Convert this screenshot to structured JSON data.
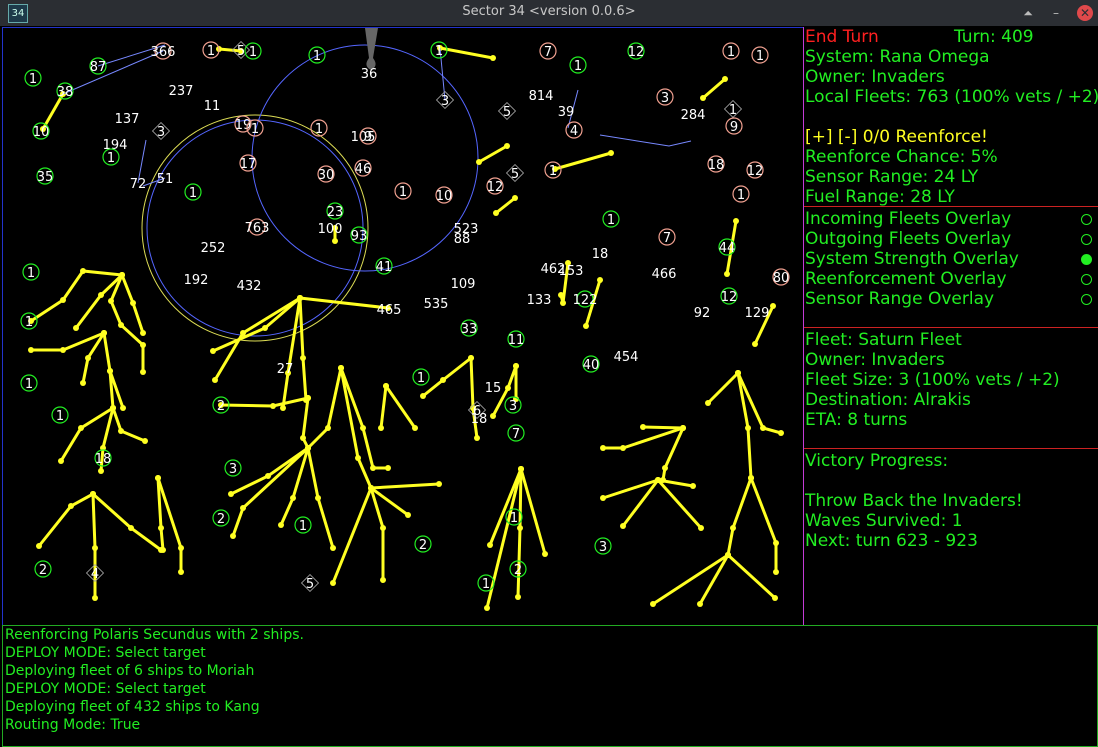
{
  "window": {
    "icon_label": "34",
    "title": "Sector 34   <version 0.0.6>",
    "buttons": [
      "minimize-up",
      "minimize",
      "close"
    ]
  },
  "side": {
    "end_turn": "End Turn",
    "turn": "Turn: 409",
    "system": "System: Rana Omega",
    "owner": "Owner: Invaders",
    "local_fleets": "Local Fleets: 763 (100% vets / +2)",
    "reenforce_plus": "[+]",
    "reenforce_minus": "[-]",
    "reenforce_status": "0/0 Reenforce!",
    "reenforce_chance": "Reenforce Chance: 5%",
    "sensor_range": "Sensor Range: 24 LY",
    "fuel_range": "Fuel Range: 28 LY",
    "overlays": [
      {
        "label": "Incoming Fleets Overlay",
        "on": false
      },
      {
        "label": "Outgoing Fleets Overlay",
        "on": false
      },
      {
        "label": "System Strength Overlay",
        "on": true
      },
      {
        "label": "Reenforcement Overlay",
        "on": false
      },
      {
        "label": "Sensor Range Overlay",
        "on": false
      }
    ],
    "fleet_name": "Fleet: Saturn Fleet",
    "fleet_owner": "Owner: Invaders",
    "fleet_size": "Fleet Size: 3 (100% vets / +2)",
    "fleet_dest": "Destination: Alrakis",
    "fleet_eta": "ETA: 8 turns",
    "victory_title": "Victory Progress:",
    "victory_goal": "Throw Back the Invaders!",
    "waves": "Waves Survived: 1",
    "next_turn": "Next: turn 623 - 923"
  },
  "log": [
    "Reenforcing Polaris Secundus with 2 ships.",
    "DEPLOY MODE: Select target",
    "Deploying fleet of 6 ships to Moriah",
    "DEPLOY MODE: Select target",
    "Deploying fleet of 432 ships to Kang",
    "Routing Mode: True"
  ],
  "colors": {
    "player": "#22ee22",
    "enemy": "#f0a090",
    "neutral": "#ffffff",
    "fleet_route": "#ffff22",
    "sensor_ring": "#5566ff",
    "fuel_ring": "#dddd55"
  },
  "map": {
    "stars": [
      {
        "label": "1",
        "kind": "p"
      },
      {
        "label": "87",
        "kind": "p"
      },
      {
        "label": "38",
        "kind": "p"
      },
      {
        "label": "10",
        "kind": "p"
      },
      {
        "label": "366",
        "kind": "e"
      },
      {
        "label": "1",
        "kind": "e"
      },
      {
        "label": "5",
        "kind": "n"
      },
      {
        "label": "1",
        "kind": "p"
      },
      {
        "label": "36",
        "kind": "n"
      },
      {
        "label": "1",
        "kind": "p"
      },
      {
        "label": "1",
        "kind": "p"
      },
      {
        "label": "7",
        "kind": "e"
      },
      {
        "label": "12",
        "kind": "p"
      },
      {
        "label": "1",
        "kind": "e"
      },
      {
        "label": "1",
        "kind": "e"
      },
      {
        "label": "237",
        "kind": "n"
      },
      {
        "label": "11",
        "kind": "n"
      },
      {
        "label": "3",
        "kind": "n"
      },
      {
        "label": "137",
        "kind": "n"
      },
      {
        "label": "194",
        "kind": "n"
      },
      {
        "label": "1",
        "kind": "p"
      },
      {
        "label": "3",
        "kind": "n"
      },
      {
        "label": "19",
        "kind": "e"
      },
      {
        "label": "1",
        "kind": "e"
      },
      {
        "label": "105",
        "kind": "n"
      },
      {
        "label": "9",
        "kind": "e"
      },
      {
        "label": "1",
        "kind": "e"
      },
      {
        "label": "5",
        "kind": "n"
      },
      {
        "label": "814",
        "kind": "n"
      },
      {
        "label": "39",
        "kind": "n"
      },
      {
        "label": "1",
        "kind": "p"
      },
      {
        "label": "4",
        "kind": "e"
      },
      {
        "label": "3",
        "kind": "e"
      },
      {
        "label": "284",
        "kind": "n"
      },
      {
        "label": "1",
        "kind": "n"
      },
      {
        "label": "9",
        "kind": "e"
      },
      {
        "label": "35",
        "kind": "p"
      },
      {
        "label": "72",
        "kind": "n"
      },
      {
        "label": "51",
        "kind": "n"
      },
      {
        "label": "17",
        "kind": "e"
      },
      {
        "label": "30",
        "kind": "e"
      },
      {
        "label": "46",
        "kind": "e"
      },
      {
        "label": "1",
        "kind": "e"
      },
      {
        "label": "10",
        "kind": "e"
      },
      {
        "label": "12",
        "kind": "e"
      },
      {
        "label": "5",
        "kind": "n"
      },
      {
        "label": "1",
        "kind": "e"
      },
      {
        "label": "18",
        "kind": "e"
      },
      {
        "label": "12",
        "kind": "e"
      },
      {
        "label": "1",
        "kind": "p"
      },
      {
        "label": "23",
        "kind": "p"
      },
      {
        "label": "100",
        "kind": "n"
      },
      {
        "label": "93",
        "kind": "p"
      },
      {
        "label": "763",
        "kind": "e"
      },
      {
        "label": "252",
        "kind": "n"
      },
      {
        "label": "523",
        "kind": "n"
      },
      {
        "label": "88",
        "kind": "n"
      },
      {
        "label": "1",
        "kind": "p"
      },
      {
        "label": "462",
        "kind": "n"
      },
      {
        "label": "153",
        "kind": "n"
      },
      {
        "label": "18",
        "kind": "n"
      },
      {
        "label": "7",
        "kind": "e"
      },
      {
        "label": "466",
        "kind": "n"
      },
      {
        "label": "44",
        "kind": "p"
      },
      {
        "label": "1",
        "kind": "e"
      },
      {
        "label": "192",
        "kind": "n"
      },
      {
        "label": "41",
        "kind": "p"
      },
      {
        "label": "432",
        "kind": "n"
      },
      {
        "label": "109",
        "kind": "n"
      },
      {
        "label": "535",
        "kind": "n"
      },
      {
        "label": "465",
        "kind": "n"
      },
      {
        "label": "133",
        "kind": "n"
      },
      {
        "label": "122",
        "kind": "p"
      },
      {
        "label": "92",
        "kind": "n"
      },
      {
        "label": "12",
        "kind": "p"
      },
      {
        "label": "129",
        "kind": "n"
      },
      {
        "label": "80",
        "kind": "e"
      },
      {
        "label": "33",
        "kind": "p"
      },
      {
        "label": "11",
        "kind": "p"
      },
      {
        "label": "454",
        "kind": "n"
      },
      {
        "label": "40",
        "kind": "p"
      },
      {
        "label": "27",
        "kind": "n"
      },
      {
        "label": "15",
        "kind": "n"
      },
      {
        "label": "18",
        "kind": "p"
      },
      {
        "label": "6",
        "kind": "n"
      },
      {
        "label": "3",
        "kind": "p"
      },
      {
        "label": "7",
        "kind": "p"
      },
      {
        "label": "18",
        "kind": "n"
      },
      {
        "label": "1",
        "kind": "p"
      },
      {
        "label": "1",
        "kind": "p"
      },
      {
        "label": "1",
        "kind": "p"
      },
      {
        "label": "1",
        "kind": "p"
      },
      {
        "label": "2",
        "kind": "p"
      },
      {
        "label": "3",
        "kind": "p"
      },
      {
        "label": "2",
        "kind": "p"
      },
      {
        "label": "1",
        "kind": "p"
      },
      {
        "label": "1",
        "kind": "p"
      },
      {
        "label": "1",
        "kind": "p"
      },
      {
        "label": "3",
        "kind": "p"
      },
      {
        "label": "2",
        "kind": "p"
      },
      {
        "label": "4",
        "kind": "n"
      },
      {
        "label": "5",
        "kind": "n"
      },
      {
        "label": "2",
        "kind": "p"
      },
      {
        "label": "1",
        "kind": "p"
      },
      {
        "label": "2",
        "kind": "p"
      }
    ]
  }
}
